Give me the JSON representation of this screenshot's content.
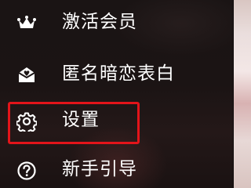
{
  "menu": {
    "items": [
      {
        "label": "激活会员",
        "icon": "crown-icon"
      },
      {
        "label": "匿名暗恋表白",
        "icon": "envelope-heart-icon"
      },
      {
        "label": "设置",
        "icon": "gear-icon"
      },
      {
        "label": "新手引导",
        "icon": "question-circle-icon"
      }
    ]
  },
  "colors": {
    "text": "#ffffff",
    "highlight_border": "#e3141a",
    "background": "#151111"
  }
}
